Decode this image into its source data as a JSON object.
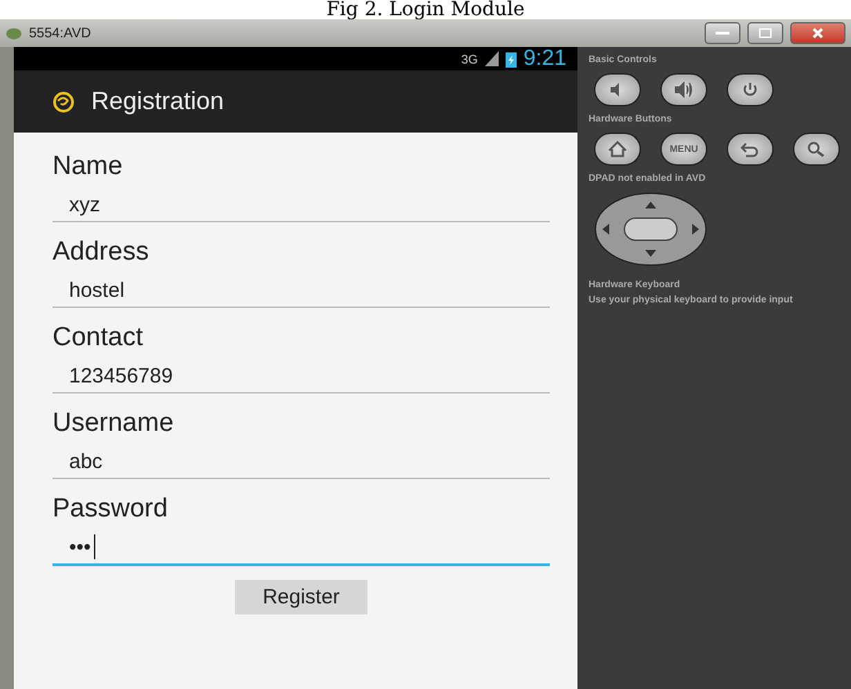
{
  "caption": "Fig 2. Login Module",
  "window": {
    "title": "5554:AVD"
  },
  "status_bar": {
    "network": "3G",
    "time": "9:21"
  },
  "action_bar": {
    "title": "Registration"
  },
  "fields": [
    {
      "label": "Name",
      "value": "xyz",
      "focused": false
    },
    {
      "label": "Address",
      "value": "hostel",
      "focused": false
    },
    {
      "label": "Contact",
      "value": "123456789",
      "focused": false
    },
    {
      "label": "Username",
      "value": "abc",
      "focused": false
    },
    {
      "label": "Password",
      "value": "•••",
      "focused": true
    }
  ],
  "button": "Register",
  "panel": {
    "basic_controls_title": "Basic Controls",
    "hardware_buttons_title": "Hardware Buttons",
    "menu_label": "MENU",
    "dpad_note": "DPAD not enabled in AVD",
    "keyboard_title": "Hardware Keyboard",
    "keyboard_note": "Use your physical keyboard to provide input"
  }
}
